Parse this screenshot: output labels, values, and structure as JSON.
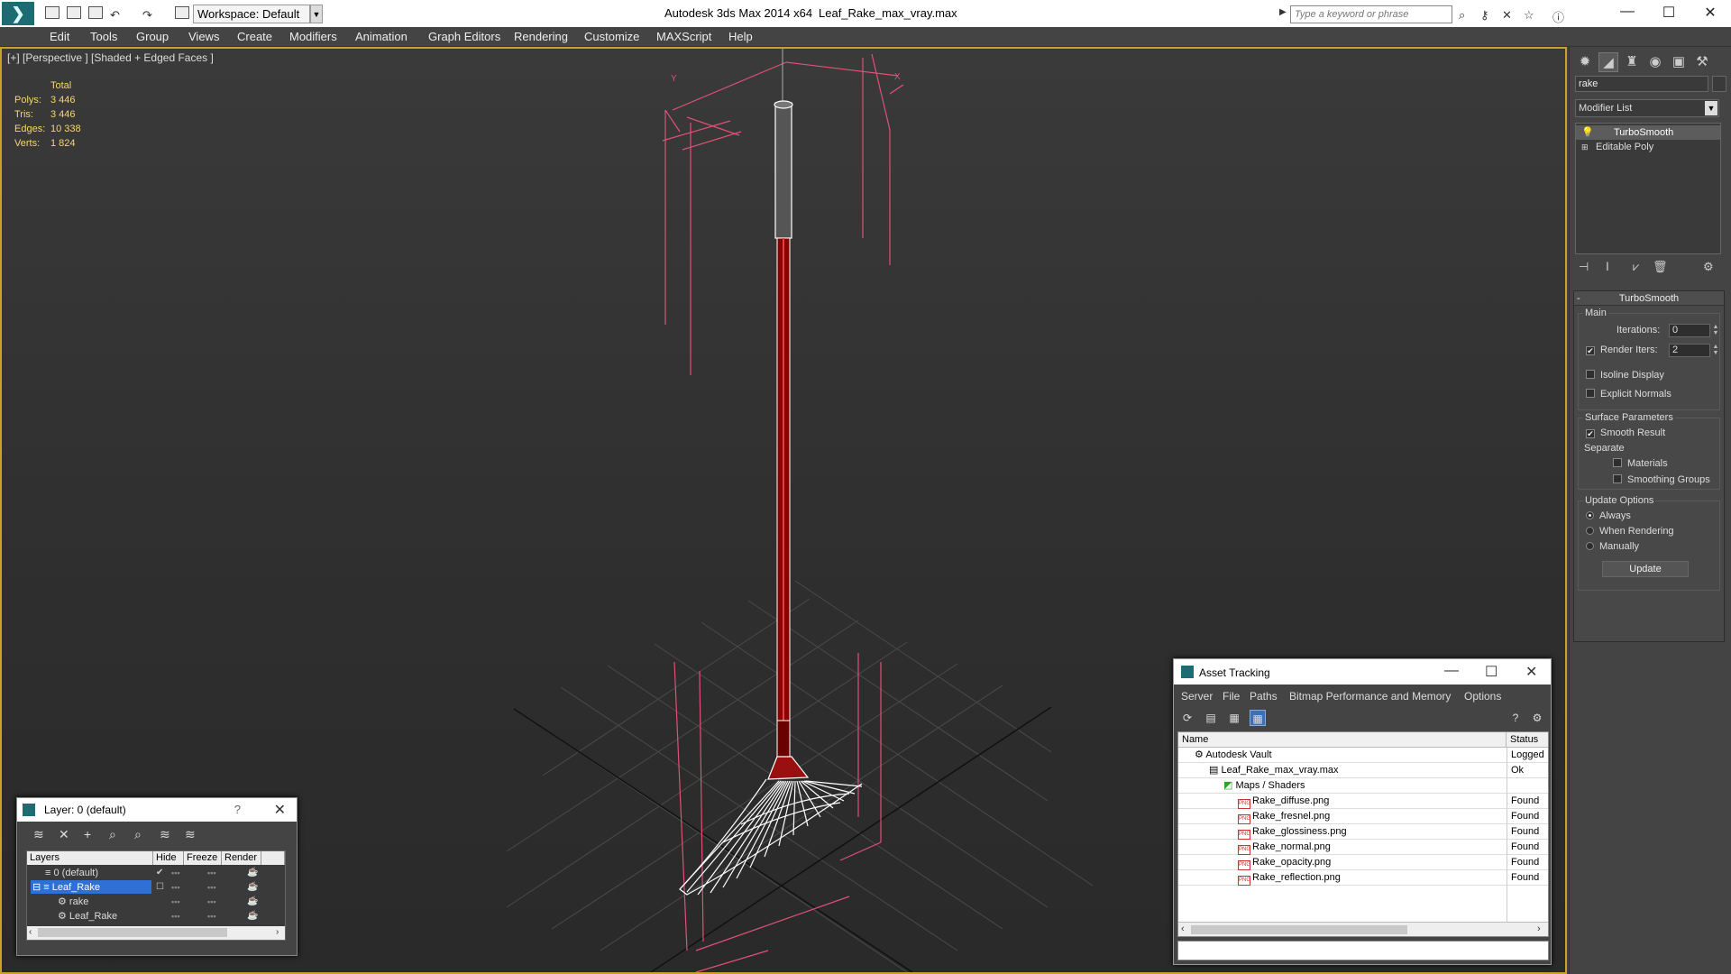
{
  "title_bar": {
    "workspace": "Workspace: Default",
    "app_name": "Autodesk 3ds Max  2014 x64",
    "file_name": "Leaf_Rake_max_vray.max",
    "search_placeholder": "Type a keyword or phrase"
  },
  "menu": [
    "Edit",
    "Tools",
    "Group",
    "Views",
    "Create",
    "Modifiers",
    "Animation",
    "Graph Editors",
    "Rendering",
    "Customize",
    "MAXScript",
    "Help"
  ],
  "viewport": {
    "label": "[+] [Perspective ] [Shaded + Edged Faces ]",
    "stats_header": "Total",
    "stats": [
      {
        "label": "Polys:",
        "value": "3 446"
      },
      {
        "label": "Tris:",
        "value": "3 446"
      },
      {
        "label": "Edges:",
        "value": "10 338"
      },
      {
        "label": "Verts:",
        "value": "1 824"
      }
    ]
  },
  "command_panel": {
    "object_name": "rake",
    "modifier_list": "Modifier List",
    "stack": [
      "TurboSmooth",
      "Editable Poly"
    ],
    "turbosmooth": {
      "title": "TurboSmooth",
      "main_group": "Main",
      "iterations_label": "Iterations:",
      "iterations_value": "0",
      "render_iters_label": "Render Iters:",
      "render_iters_value": "2",
      "render_iters_checked": true,
      "isoline_label": "Isoline Display",
      "explicit_normals_label": "Explicit Normals",
      "surface_group": "Surface Parameters",
      "smooth_result_label": "Smooth Result",
      "separate_label": "Separate",
      "materials_label": "Materials",
      "smoothing_groups_label": "Smoothing Groups",
      "update_group": "Update Options",
      "always_label": "Always",
      "when_rendering_label": "When Rendering",
      "manually_label": "Manually",
      "update_button": "Update"
    }
  },
  "layer_dialog": {
    "title": "Layer: 0 (default)",
    "help": "?",
    "columns": [
      "Layers",
      "Hide",
      "Freeze",
      "Render"
    ],
    "rows": [
      {
        "name": "0 (default)",
        "active": true
      },
      {
        "name": "Leaf_Rake",
        "selected": true
      },
      {
        "name": "rake"
      },
      {
        "name": "Leaf_Rake"
      }
    ]
  },
  "asset_tracking": {
    "title": "Asset Tracking",
    "menu": [
      "Server",
      "File",
      "Paths",
      "Bitmap Performance and Memory",
      "Options"
    ],
    "columns": [
      "Name",
      "Status"
    ],
    "rows": [
      {
        "name": "Autodesk Vault",
        "status": "Logged"
      },
      {
        "name": "Leaf_Rake_max_vray.max",
        "status": "Ok"
      },
      {
        "name": "Maps / Shaders",
        "status": ""
      },
      {
        "name": "Rake_diffuse.png",
        "status": "Found"
      },
      {
        "name": "Rake_fresnel.png",
        "status": "Found"
      },
      {
        "name": "Rake_glossiness.png",
        "status": "Found"
      },
      {
        "name": "Rake_normal.png",
        "status": "Found"
      },
      {
        "name": "Rake_opacity.png",
        "status": "Found"
      },
      {
        "name": "Rake_reflection.png",
        "status": "Found"
      }
    ]
  },
  "colors": {
    "viewport_border": "#c9a227",
    "stats_text": "#f5d76e",
    "selection": "#2f6fd6",
    "rake_handle": "#8b0000",
    "bbox": "#e0507a"
  }
}
